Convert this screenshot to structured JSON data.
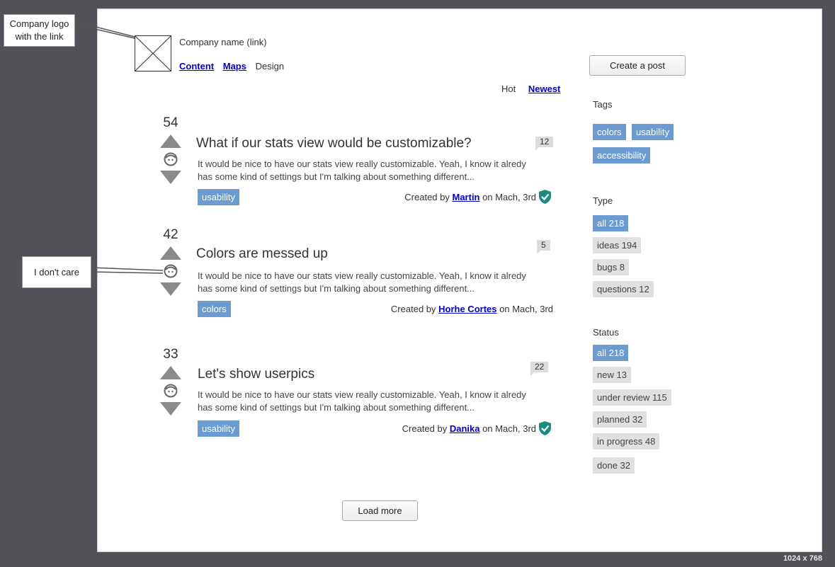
{
  "annotations": {
    "logo_note": "Company logo with the link",
    "vote_note": "I don't care"
  },
  "size_label": "1024 x 768",
  "header": {
    "company_name": "Company name (link)",
    "nav": [
      "Content",
      "Maps",
      "Design"
    ],
    "create_post": "Create a post"
  },
  "sort": {
    "hot": "Hot",
    "newest": "Newest"
  },
  "posts": [
    {
      "votes": "54",
      "title": "What if our stats view would be customizable?",
      "desc_1": "It would be nice to have our stats view really customizable. Yeah, I know it alredy",
      "desc_2": "has some kind of settings but I'm talking about something different...",
      "tag": "usability",
      "created": "Created by",
      "author": "Martin",
      "date": "on Mach, 3rd",
      "comments": "12",
      "verified": true
    },
    {
      "votes": "42",
      "title": "Colors are messed up",
      "desc_1": "It would be nice to have our stats view really customizable. Yeah, I know it alredy",
      "desc_2": "has some kind of settings but I'm talking about something different...",
      "tag": "colors",
      "created": "Created by",
      "author": "Horhe Cortes",
      "date": "on Mach, 3rd",
      "comments": "5",
      "verified": false
    },
    {
      "votes": "33",
      "title": "Let's show userpics",
      "desc_1": "It would be nice to have our stats view really customizable. Yeah, I know it alredy",
      "desc_2": "has some kind of settings but I'm talking about something different...",
      "tag": "usability",
      "created": "Created by",
      "author": "Danika",
      "date": "on Mach, 3rd",
      "comments": "22",
      "verified": true
    }
  ],
  "load_more": "Load more",
  "sidebar": {
    "tags_title": "Tags",
    "tags": [
      "colors",
      "usability",
      "accessibility"
    ],
    "type_title": "Type",
    "types": [
      "all 218",
      "ideas 194",
      "bugs 8",
      "questions 12"
    ],
    "status_title": "Status",
    "statuses": [
      "all 218",
      "new 13",
      "under review 115",
      "planned 32",
      "in progress 48",
      "done 32"
    ]
  },
  "colors": {
    "accent": "#6a9bd1",
    "chip": "#e0e0e0",
    "shield": "#1b8a7f",
    "link": "#0000cc"
  }
}
